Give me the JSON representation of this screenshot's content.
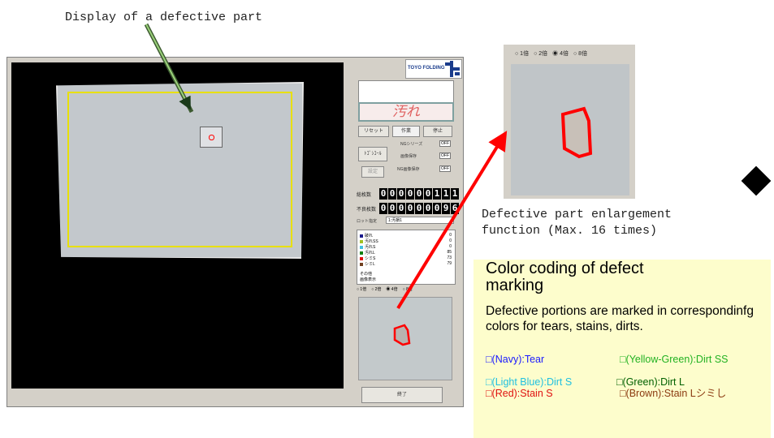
{
  "captions": {
    "top": "Display of a defective part",
    "enlargement": "Defective part enlargement\nfunction (Max. 16 times)"
  },
  "main_window": {
    "logo_text": "TOYO FOLDING",
    "defect_label": "汚れ",
    "buttons": {
      "reset": "リセット",
      "run": "作業",
      "stop": "停止",
      "setting": "設定",
      "close": "終了"
    },
    "toggles": [
      {
        "label": "NGシリーズ",
        "value": "OFF"
      },
      {
        "label": "画像保存",
        "value": "OFF"
      },
      {
        "label": "NG画像保存",
        "value": "OFF"
      }
    ],
    "counters": [
      {
        "label": "総枚数",
        "digits": "000000111"
      },
      {
        "label": "不良枚数",
        "digits": "000000096"
      }
    ],
    "lot_label": "ロット指定",
    "lot_value": "1:汚損1",
    "legend": [
      {
        "name": "破れ",
        "color": "#1a1a8c",
        "value": "0"
      },
      {
        "name": "汚れSS",
        "color": "#a0c020",
        "value": "0"
      },
      {
        "name": "汚れS",
        "color": "#40c0e0",
        "value": "0"
      },
      {
        "name": "汚れL",
        "color": "#108010",
        "value": "85"
      },
      {
        "name": "シミS",
        "color": "#e01010",
        "value": "73"
      },
      {
        "name": "シミL",
        "color": "#704020",
        "value": "79"
      }
    ],
    "legend_extra": [
      "その他",
      "画像表示"
    ],
    "zoom_options": [
      "1倍",
      "2倍",
      "4倍",
      "8倍"
    ]
  },
  "enlargement_window": {
    "zoom_options": [
      "1倍",
      "2倍",
      "4倍",
      "8倍"
    ],
    "selected": "4倍"
  },
  "color_coding": {
    "title": "Color coding of defect marking",
    "description": "Defective portions are marked in correspondinfg colors for tears, stains, dirts.",
    "items": [
      {
        "text": "□(Navy):Tear",
        "color": "#1a1aff"
      },
      {
        "text": "□(Yellow-Green):Dirt SS",
        "color": "#22b222"
      },
      {
        "text": "□(Light Blue):Dirt S",
        "color": "#20c0e0"
      },
      {
        "text": "□(Green):Dirt L",
        "color": "#006000"
      },
      {
        "text": "□(Red):Stain S",
        "color": "#e01010"
      },
      {
        "text": "□(Brown):Stain Lシミし",
        "color": "#8b3a10"
      }
    ]
  }
}
